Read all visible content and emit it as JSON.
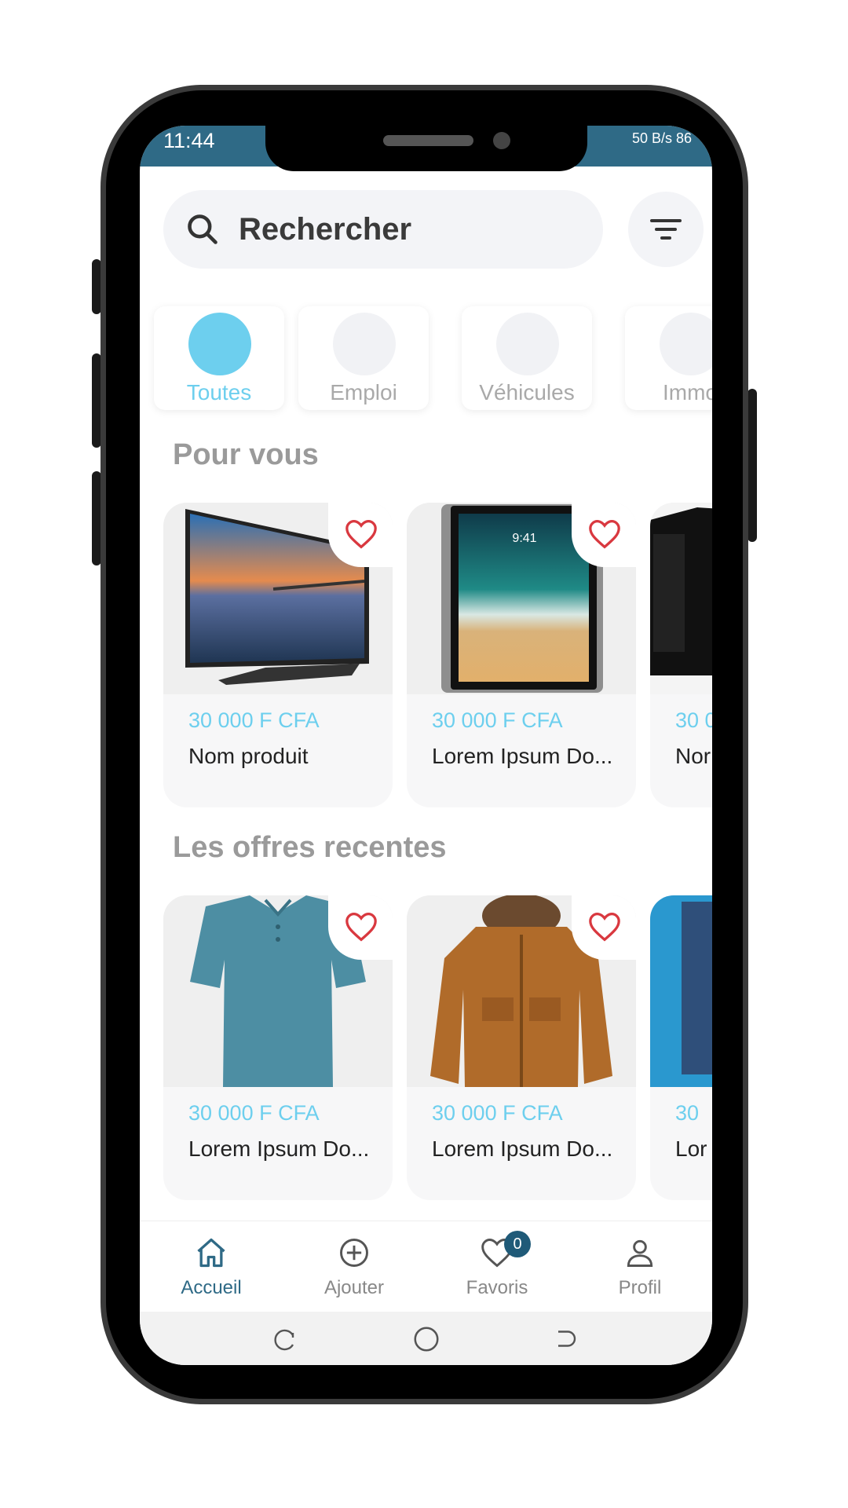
{
  "status_bar": {
    "time": "11:44",
    "right": "50 B/s 86"
  },
  "search": {
    "placeholder": "Rechercher"
  },
  "categories": [
    {
      "label": "Toutes",
      "active": true
    },
    {
      "label": "Emploi",
      "active": false
    },
    {
      "label": "Véhicules",
      "active": false
    },
    {
      "label": "Immo",
      "active": false
    }
  ],
  "sections": {
    "for_you": "Pour vous",
    "recent": "Les offres recentes"
  },
  "for_you_products": [
    {
      "price": "30 000 F CFA",
      "name": "Nom produit",
      "image": "tv"
    },
    {
      "price": "30 000 F CFA",
      "name": "Lorem Ipsum Do...",
      "image": "tablet"
    },
    {
      "price": "30 0",
      "name": "Nor",
      "image": "computer"
    }
  ],
  "recent_products": [
    {
      "price": "30 000 F CFA",
      "name": "Lorem Ipsum Do...",
      "image": "polo-shirt"
    },
    {
      "price": "30 000 F CFA",
      "name": "Lorem Ipsum Do...",
      "image": "jacket"
    },
    {
      "price": "30",
      "name": "Lor",
      "image": "jeans"
    }
  ],
  "bottom_nav": [
    {
      "label": "Accueil",
      "icon": "home-icon",
      "active": true
    },
    {
      "label": "Ajouter",
      "icon": "add-circle-icon",
      "active": false
    },
    {
      "label": "Favoris",
      "icon": "heart-icon",
      "active": false,
      "badge": "0"
    },
    {
      "label": "Profil",
      "icon": "user-icon",
      "active": false
    }
  ],
  "colors": {
    "accent": "#6dcfee",
    "primary": "#2f6a86",
    "heart": "#d9383f"
  }
}
